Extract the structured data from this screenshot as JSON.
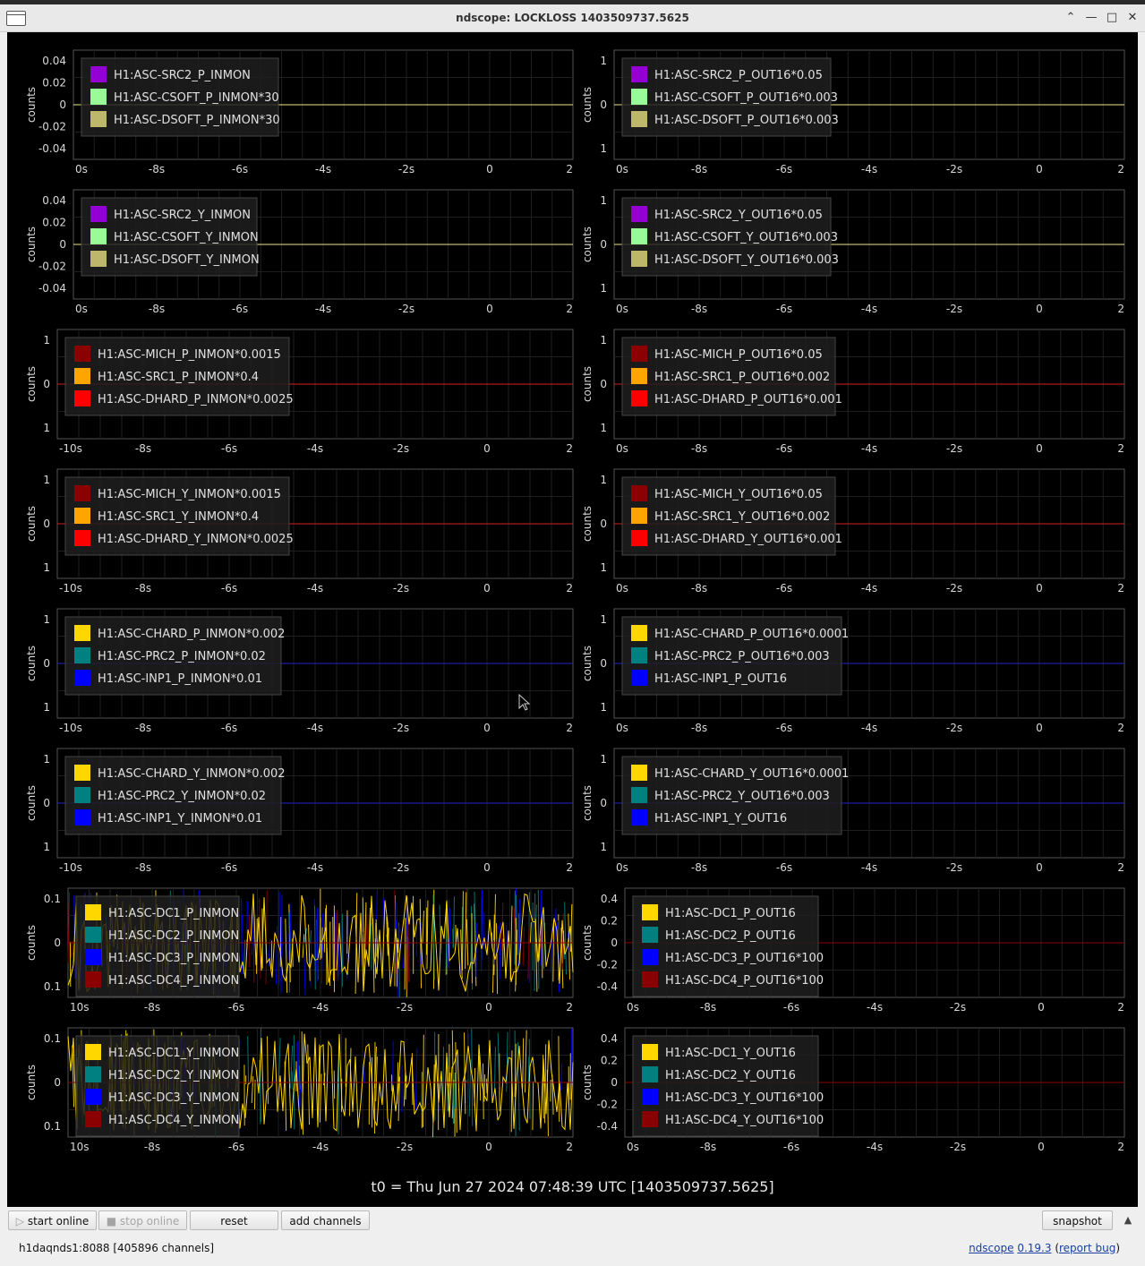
{
  "window": {
    "title": "ndscope: LOCKLOSS 1403509737.5625"
  },
  "ylabel": "counts",
  "tick_color": "#d8d8d8",
  "t0_label": "t0 = Thu Jun 27 2024 07:48:39 UTC [1403509737.5625]",
  "buttons": {
    "start_online": "start online",
    "stop_online": "stop online",
    "reset": "reset",
    "add_channels": "add channels",
    "snapshot": "snapshot"
  },
  "status": "h1daqnds1:8088  [405896 channels]",
  "about": {
    "name": "ndscope",
    "version": "0.19.3",
    "report": "report bug"
  },
  "plots": [
    {
      "id": "r1l",
      "xticks": [
        "0s",
        "-8s",
        "-6s",
        "-4s",
        "-2s",
        "0",
        "2"
      ],
      "yticks": [
        "0.04",
        "0.02",
        "0",
        "-0.02",
        "-0.04"
      ],
      "zero_line": "#f0e68c",
      "legend": [
        {
          "name": "H1:ASC-SRC2_P_INMON",
          "color": "#9400d3"
        },
        {
          "name": "H1:ASC-CSOFT_P_INMON*30",
          "color": "#98fb98"
        },
        {
          "name": "H1:ASC-DSOFT_P_INMON*30",
          "color": "#bdb76b"
        }
      ]
    },
    {
      "id": "r1r",
      "xticks": [
        "0s",
        "-8s",
        "-6s",
        "-4s",
        "-2s",
        "0",
        "2"
      ],
      "yticks": [
        "1",
        "0",
        "1"
      ],
      "zero_line": "#f0e68c",
      "legend": [
        {
          "name": "H1:ASC-SRC2_P_OUT16*0.05",
          "color": "#9400d3"
        },
        {
          "name": "H1:ASC-CSOFT_P_OUT16*0.003",
          "color": "#98fb98"
        },
        {
          "name": "H1:ASC-DSOFT_P_OUT16*0.003",
          "color": "#bdb76b"
        }
      ]
    },
    {
      "id": "r2l",
      "xticks": [
        "0s",
        "-8s",
        "-6s",
        "-4s",
        "-2s",
        "0",
        "2"
      ],
      "yticks": [
        "0.04",
        "0.02",
        "0",
        "-0.02",
        "-0.04"
      ],
      "zero_line": "#f0e68c",
      "legend": [
        {
          "name": "H1:ASC-SRC2_Y_INMON",
          "color": "#9400d3"
        },
        {
          "name": "H1:ASC-CSOFT_Y_INMON",
          "color": "#98fb98"
        },
        {
          "name": "H1:ASC-DSOFT_Y_INMON",
          "color": "#bdb76b"
        }
      ]
    },
    {
      "id": "r2r",
      "xticks": [
        "0s",
        "-8s",
        "-6s",
        "-4s",
        "-2s",
        "0",
        "2"
      ],
      "yticks": [
        "1",
        "0",
        "1"
      ],
      "zero_line": "#f0e68c",
      "legend": [
        {
          "name": "H1:ASC-SRC2_Y_OUT16*0.05",
          "color": "#9400d3"
        },
        {
          "name": "H1:ASC-CSOFT_Y_OUT16*0.003",
          "color": "#98fb98"
        },
        {
          "name": "H1:ASC-DSOFT_Y_OUT16*0.003",
          "color": "#bdb76b"
        }
      ]
    },
    {
      "id": "r3l",
      "xticks": [
        "-10s",
        "-8s",
        "-6s",
        "-4s",
        "-2s",
        "0",
        "2"
      ],
      "yticks": [
        "1",
        "0",
        "1"
      ],
      "zero_line": "#d22222",
      "legend": [
        {
          "name": "H1:ASC-MICH_P_INMON*0.0015",
          "color": "#8b0000"
        },
        {
          "name": "H1:ASC-SRC1_P_INMON*0.4",
          "color": "#ffa500"
        },
        {
          "name": "H1:ASC-DHARD_P_INMON*0.0025",
          "color": "#ff0000"
        }
      ]
    },
    {
      "id": "r3r",
      "xticks": [
        "0s",
        "-8s",
        "-6s",
        "-4s",
        "-2s",
        "0",
        "2"
      ],
      "yticks": [
        "1",
        "0",
        "1"
      ],
      "zero_line": "#d22222",
      "legend": [
        {
          "name": "H1:ASC-MICH_P_OUT16*0.05",
          "color": "#8b0000"
        },
        {
          "name": "H1:ASC-SRC1_P_OUT16*0.002",
          "color": "#ffa500"
        },
        {
          "name": "H1:ASC-DHARD_P_OUT16*0.001",
          "color": "#ff0000"
        }
      ]
    },
    {
      "id": "r4l",
      "xticks": [
        "-10s",
        "-8s",
        "-6s",
        "-4s",
        "-2s",
        "0",
        "2"
      ],
      "yticks": [
        "1",
        "0",
        "1"
      ],
      "zero_line": "#d22222",
      "legend": [
        {
          "name": "H1:ASC-MICH_Y_INMON*0.0015",
          "color": "#8b0000"
        },
        {
          "name": "H1:ASC-SRC1_Y_INMON*0.4",
          "color": "#ffa500"
        },
        {
          "name": "H1:ASC-DHARD_Y_INMON*0.0025",
          "color": "#ff0000"
        }
      ]
    },
    {
      "id": "r4r",
      "xticks": [
        "0s",
        "-8s",
        "-6s",
        "-4s",
        "-2s",
        "0",
        "2"
      ],
      "yticks": [
        "1",
        "0",
        "1"
      ],
      "zero_line": "#d22222",
      "legend": [
        {
          "name": "H1:ASC-MICH_Y_OUT16*0.05",
          "color": "#8b0000"
        },
        {
          "name": "H1:ASC-SRC1_Y_OUT16*0.002",
          "color": "#ffa500"
        },
        {
          "name": "H1:ASC-DHARD_Y_OUT16*0.001",
          "color": "#ff0000"
        }
      ]
    },
    {
      "id": "r5l",
      "xticks": [
        "-10s",
        "-8s",
        "-6s",
        "-4s",
        "-2s",
        "0",
        "2"
      ],
      "yticks": [
        "1",
        "0",
        "1"
      ],
      "zero_line": "#2222cc",
      "legend": [
        {
          "name": "H1:ASC-CHARD_P_INMON*0.002",
          "color": "#ffd700"
        },
        {
          "name": "H1:ASC-PRC2_P_INMON*0.02",
          "color": "#008080"
        },
        {
          "name": "H1:ASC-INP1_P_INMON*0.01",
          "color": "#0000ff"
        }
      ]
    },
    {
      "id": "r5r",
      "xticks": [
        "0s",
        "-8s",
        "-6s",
        "-4s",
        "-2s",
        "0",
        "2"
      ],
      "yticks": [
        "1",
        "0",
        "1"
      ],
      "zero_line": "#2222cc",
      "legend": [
        {
          "name": "H1:ASC-CHARD_P_OUT16*0.0001",
          "color": "#ffd700"
        },
        {
          "name": "H1:ASC-PRC2_P_OUT16*0.003",
          "color": "#008080"
        },
        {
          "name": "H1:ASC-INP1_P_OUT16",
          "color": "#0000ff"
        }
      ]
    },
    {
      "id": "r6l",
      "xticks": [
        "-10s",
        "-8s",
        "-6s",
        "-4s",
        "-2s",
        "0",
        "2"
      ],
      "yticks": [
        "1",
        "0",
        "1"
      ],
      "zero_line": "#2222cc",
      "legend": [
        {
          "name": "H1:ASC-CHARD_Y_INMON*0.002",
          "color": "#ffd700"
        },
        {
          "name": "H1:ASC-PRC2_Y_INMON*0.02",
          "color": "#008080"
        },
        {
          "name": "H1:ASC-INP1_Y_INMON*0.01",
          "color": "#0000ff"
        }
      ]
    },
    {
      "id": "r6r",
      "xticks": [
        "0s",
        "-8s",
        "-6s",
        "-4s",
        "-2s",
        "0",
        "2"
      ],
      "yticks": [
        "1",
        "0",
        "1"
      ],
      "zero_line": "#2222cc",
      "legend": [
        {
          "name": "H1:ASC-CHARD_Y_OUT16*0.0001",
          "color": "#ffd700"
        },
        {
          "name": "H1:ASC-PRC2_Y_OUT16*0.003",
          "color": "#008080"
        },
        {
          "name": "H1:ASC-INP1_Y_OUT16",
          "color": "#0000ff"
        }
      ]
    },
    {
      "id": "r7l",
      "xticks": [
        "10s",
        "-8s",
        "-6s",
        "-4s",
        "-2s",
        "0",
        "2"
      ],
      "yticks": [
        "0.1",
        "0",
        "0.1"
      ],
      "zero_line": "#8b0000",
      "noisy": "dense",
      "legend": [
        {
          "name": "H1:ASC-DC1_P_INMON",
          "color": "#ffd700"
        },
        {
          "name": "H1:ASC-DC2_P_INMON",
          "color": "#008080"
        },
        {
          "name": "H1:ASC-DC3_P_INMON",
          "color": "#0000ff"
        },
        {
          "name": "H1:ASC-DC4_P_INMON",
          "color": "#8b0000"
        }
      ]
    },
    {
      "id": "r7r",
      "xticks": [
        "0s",
        "-8s",
        "-6s",
        "-4s",
        "-2s",
        "0",
        "2"
      ],
      "yticks": [
        "0.4",
        "0.2",
        "0",
        "-0.2",
        "-0.4"
      ],
      "zero_line": "#8b0000",
      "legend": [
        {
          "name": "H1:ASC-DC1_P_OUT16",
          "color": "#ffd700"
        },
        {
          "name": "H1:ASC-DC2_P_OUT16",
          "color": "#008080"
        },
        {
          "name": "H1:ASC-DC3_P_OUT16*100",
          "color": "#0000ff"
        },
        {
          "name": "H1:ASC-DC4_P_OUT16*100",
          "color": "#8b0000"
        }
      ]
    },
    {
      "id": "r8l",
      "xticks": [
        "10s",
        "-8s",
        "-6s",
        "-4s",
        "-2s",
        "0",
        "2"
      ],
      "yticks": [
        "0.1",
        "0",
        "0.1"
      ],
      "zero_line": "#8b0000",
      "noisy": "yellow",
      "legend": [
        {
          "name": "H1:ASC-DC1_Y_INMON",
          "color": "#ffd700"
        },
        {
          "name": "H1:ASC-DC2_Y_INMON",
          "color": "#008080"
        },
        {
          "name": "H1:ASC-DC3_Y_INMON",
          "color": "#0000ff"
        },
        {
          "name": "H1:ASC-DC4_Y_INMON",
          "color": "#8b0000"
        }
      ]
    },
    {
      "id": "r8r",
      "xticks": [
        "0s",
        "-8s",
        "-6s",
        "-4s",
        "-2s",
        "0",
        "2"
      ],
      "yticks": [
        "0.4",
        "0.2",
        "0",
        "-0.2",
        "-0.4"
      ],
      "zero_line": "#8b0000",
      "legend": [
        {
          "name": "H1:ASC-DC1_Y_OUT16",
          "color": "#ffd700"
        },
        {
          "name": "H1:ASC-DC2_Y_OUT16",
          "color": "#008080"
        },
        {
          "name": "H1:ASC-DC3_Y_OUT16*100",
          "color": "#0000ff"
        },
        {
          "name": "H1:ASC-DC4_Y_OUT16*100",
          "color": "#8b0000"
        }
      ]
    }
  ]
}
